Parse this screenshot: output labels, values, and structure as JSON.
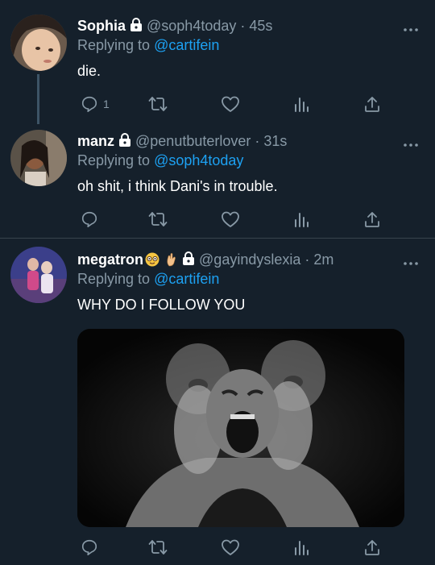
{
  "tweets": [
    {
      "name": "Sophia",
      "handle": "@soph4today",
      "time": "· 45s",
      "replying_prefix": "Replying to",
      "replying_to": "@cartifein",
      "text": "die.",
      "reply_count": "1",
      "avatar_icon": "avatar-photo"
    },
    {
      "name": "manz",
      "handle": "@penutbuterlover",
      "time": "· 31s",
      "replying_prefix": "Replying to",
      "replying_to": "@soph4today",
      "text": "oh shit, i think Dani's in trouble.",
      "reply_count": "",
      "avatar_icon": "avatar-photo"
    },
    {
      "name": "megatron",
      "handle": "@gayindyslexia",
      "time": "· 2m",
      "replying_prefix": "Replying to",
      "replying_to": "@cartifein",
      "text": "WHY DO I FOLLOW YOU",
      "reply_count": "",
      "avatar_icon": "avatar-photo",
      "name_emojis": [
        "nerd-face-emoji",
        "pinching-hand-emoji"
      ],
      "media": "screaming-man-gif"
    }
  ],
  "colors": {
    "background": "#15202b",
    "secondary_text": "#8899a6",
    "mention": "#1da1f2",
    "divider": "#38444d"
  }
}
